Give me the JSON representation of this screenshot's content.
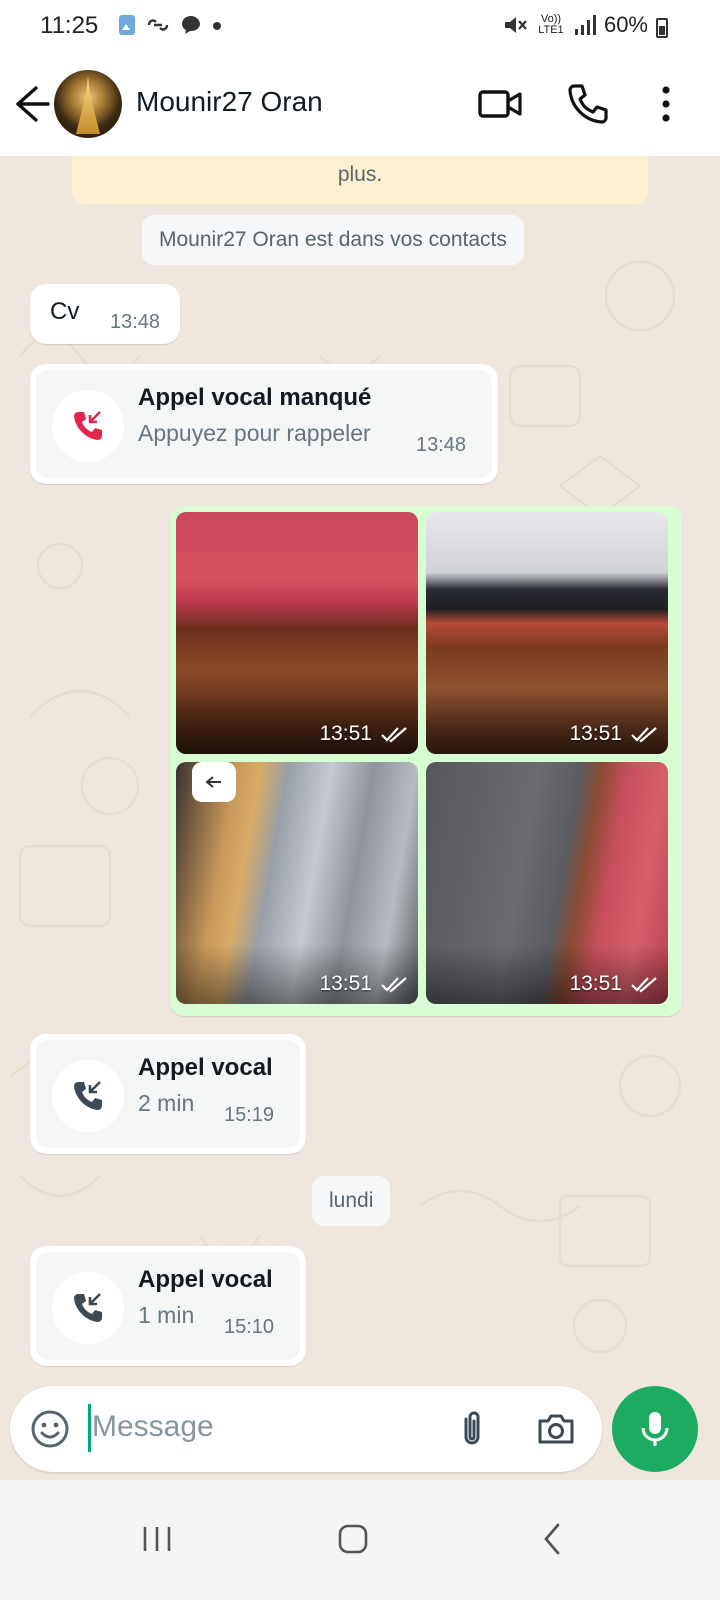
{
  "status_bar": {
    "time": "11:25",
    "network": "Vo)) LTE1",
    "battery": "60%"
  },
  "header": {
    "contact_name": "Mounir27 Oran"
  },
  "chat": {
    "encryption_notice_tail": "plus.",
    "contact_notice": "Mounir27 Oran est dans vos contacts",
    "messages": [
      {
        "type": "text",
        "text": "Cv",
        "time": "13:48"
      },
      {
        "type": "call",
        "title": "Appel vocal manqué",
        "subtitle": "Appuyez pour rappeler",
        "time": "13:48",
        "missed": true
      },
      {
        "type": "media",
        "photos": [
          {
            "time": "13:51",
            "subject": "red sofa on wooden floor"
          },
          {
            "time": "13:51",
            "subject": "sofa bed partially opened"
          },
          {
            "time": "13:51",
            "subject": "sofa bed frame slats"
          },
          {
            "time": "13:51",
            "subject": "folded mattress on red sofa"
          }
        ]
      },
      {
        "type": "call",
        "title": "Appel vocal",
        "subtitle": "2 min",
        "time": "15:19",
        "missed": false
      },
      {
        "type": "date",
        "text": "lundi"
      },
      {
        "type": "call",
        "title": "Appel vocal",
        "subtitle": "1 min",
        "time": "15:10",
        "missed": false
      }
    ]
  },
  "input": {
    "placeholder": "Message"
  },
  "colors": {
    "accent_green": "#1daa61",
    "outgoing_bubble": "#d9fdd3",
    "missed_red": "#e2264d"
  }
}
